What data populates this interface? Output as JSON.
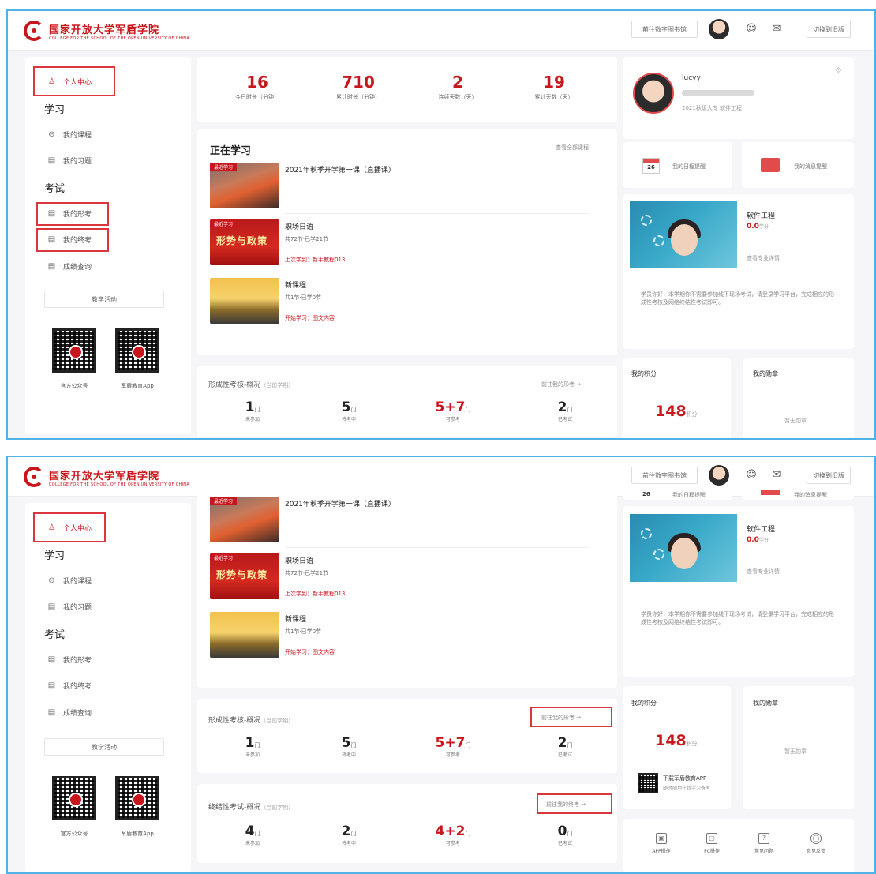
{
  "app": {
    "logo_cn": "国家开放大学军盾学院",
    "logo_en": "COLLEGE FOR THE SCHOOL OF THE OPEN UNIVERSITY OF CHINA",
    "top_btn1": "前往数字图书馆",
    "top_btn2": "切换到旧版"
  },
  "sidebar": {
    "personal_center": "个人中心",
    "study_head": "学习",
    "my_courses": "我的课程",
    "my_exercises": "我的习题",
    "exam_head": "考试",
    "my_formative": "我的形考",
    "my_final": "我的终考",
    "grades": "成绩查询",
    "learning_guide": "教学活动",
    "qr1_label": "官方公众号",
    "qr2_label": "军盾教育App"
  },
  "stats": [
    {
      "value": "16",
      "label": "今日时长（分钟）"
    },
    {
      "value": "710",
      "label": "累计时长（分钟）"
    },
    {
      "value": "2",
      "label": "连续天数（天）"
    },
    {
      "value": "19",
      "label": "累计天数（天）"
    }
  ],
  "learning": {
    "title": "正在学习",
    "view_all": "查看全部课程",
    "courses": [
      {
        "tag": "最近学习",
        "title": "2021年秋季开学第一课（直播课）",
        "meta": "",
        "red": ""
      },
      {
        "tag": "最近学习",
        "cover": "形势与政策",
        "title": "职场日语",
        "meta": "共72节·已学21节",
        "red": "上次学到：新手教程013"
      },
      {
        "tag": "",
        "title": "新课程",
        "meta": "共1节·已学0节",
        "red": "开始学习：图文内容"
      }
    ]
  },
  "formative": {
    "title": "形成性考核-概况",
    "term": "（当前学期）",
    "link": "前往我的形考 →",
    "items": [
      {
        "value": "1",
        "unit": "门",
        "label": "未参加"
      },
      {
        "value": "5",
        "unit": "门",
        "label": "将考中"
      },
      {
        "value": "5+7",
        "unit": "门",
        "label": "可参考"
      },
      {
        "value": "2",
        "unit": "门",
        "label": "已考试"
      }
    ]
  },
  "final": {
    "title": "终结性考试-概况",
    "term": "（当前学期）",
    "link": "前往我的终考 →",
    "items": [
      {
        "value": "4",
        "unit": "门",
        "label": "未参加"
      },
      {
        "value": "2",
        "unit": "门",
        "label": "将考中"
      },
      {
        "value": "4+2",
        "unit": "门",
        "label": "可参考"
      },
      {
        "value": "0",
        "unit": "门",
        "label": "已考试"
      }
    ]
  },
  "profile": {
    "name": "lucyy",
    "info": "2021秋级大专  软件工程"
  },
  "tiles": {
    "calendar_day": "26",
    "calendar_label": "我的日程提醒",
    "message_label": "我的消息提醒"
  },
  "major": {
    "name": "软件工程",
    "score": "0.0",
    "score_unit": "学分",
    "link": "查看专业详情",
    "notice": "学员你好，本学期你不需要参加线下现场考试，请登录学习平台，完成相应的形成性考核及网络终结性考试即可。"
  },
  "points": {
    "label": "我的积分",
    "value": "148",
    "unit": "积分",
    "app_title": "下载军盾教育APP",
    "app_sub": "随时随地在线学习备考"
  },
  "badges": {
    "label": "我的勋章",
    "empty": "暂无勋章"
  },
  "tools": [
    {
      "icon": "▣",
      "label": "APP操作"
    },
    {
      "icon": "▢",
      "label": "PC操作"
    },
    {
      "icon": "?",
      "label": "常见问题"
    },
    {
      "icon": "◯",
      "label": "意见反馈"
    }
  ],
  "colors": {
    "brand_red": "#c8161d",
    "annotation_border": "#4fb3e8",
    "highlight_box": "#d9363e"
  }
}
